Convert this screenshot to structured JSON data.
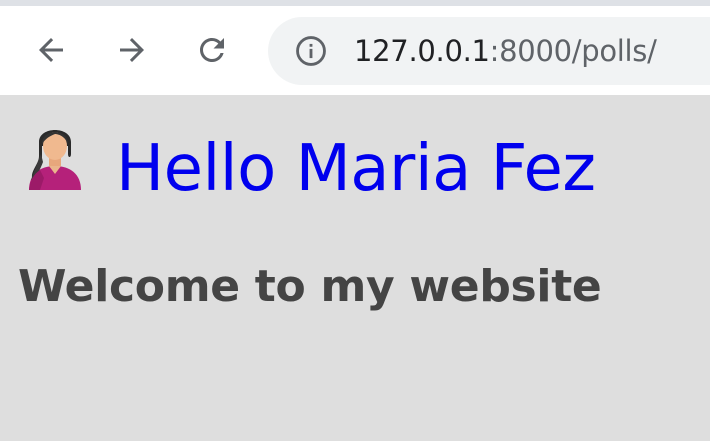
{
  "browser": {
    "url": {
      "host": "127.0.0.1",
      "rest": ":8000/polls/"
    },
    "icons": {
      "back": "back-arrow-icon",
      "forward": "forward-arrow-icon",
      "reload": "reload-icon",
      "site_info": "info-circle-icon"
    },
    "colors": {
      "toolbar": "#ffffff",
      "omnibox": "#f1f3f4",
      "icon": "#5f6368"
    }
  },
  "page": {
    "greeting": "Hello Maria Fez",
    "welcome": "Welcome to my website",
    "avatar_icon": "woman-user-avatar-icon",
    "colors": {
      "background": "#dedede",
      "greeting": "#0000ee",
      "welcome": "#444444"
    }
  }
}
